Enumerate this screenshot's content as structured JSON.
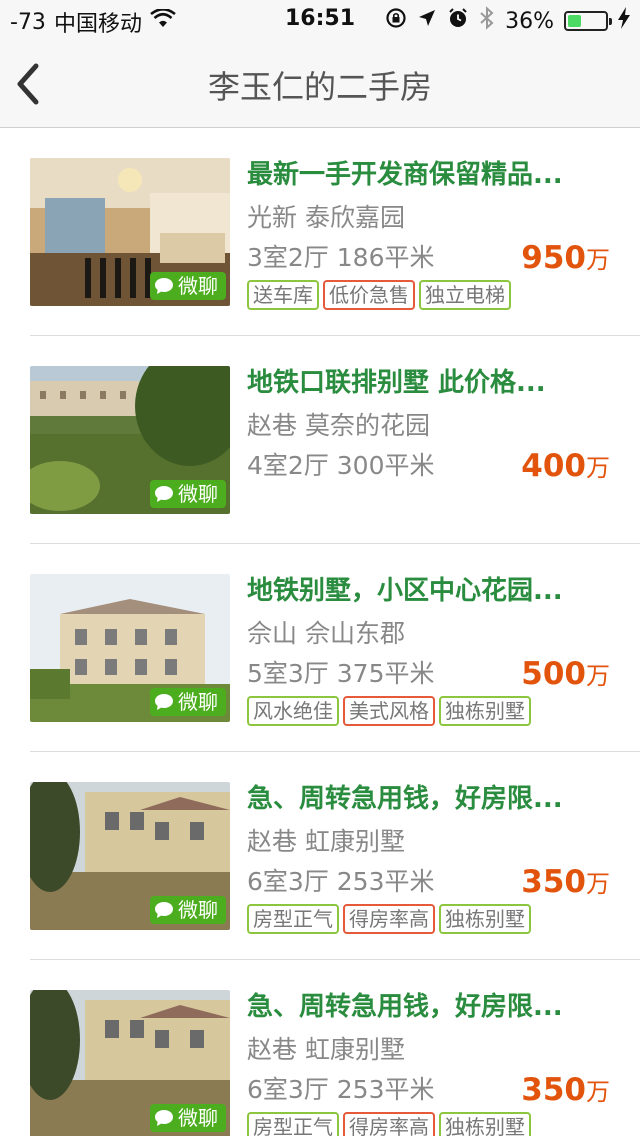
{
  "status_bar": {
    "signal": "-73",
    "carrier": "中国移动",
    "time": "16:51",
    "battery_percent": "36%",
    "battery_level": 0.36
  },
  "nav": {
    "title": "李玉仁的二手房"
  },
  "chat_label": "微聊",
  "listings": [
    {
      "title": "最新一手开发商保留精品...",
      "location": "光新  泰欣嘉园",
      "spec": "3室2厅  186平米",
      "price": "950",
      "unit": "万",
      "tags": [
        {
          "label": "送车库",
          "color": "green"
        },
        {
          "label": "低价急售",
          "color": "red"
        },
        {
          "label": "独立电梯",
          "color": "green"
        }
      ]
    },
    {
      "title": "地铁口联排别墅 此价格...",
      "location": "赵巷  莫奈的花园",
      "spec": "4室2厅  300平米",
      "price": "400",
      "unit": "万",
      "tags": []
    },
    {
      "title": "地铁别墅，小区中心花园...",
      "location": "佘山  佘山东郡",
      "spec": "5室3厅  375平米",
      "price": "500",
      "unit": "万",
      "tags": [
        {
          "label": "风水绝佳",
          "color": "green"
        },
        {
          "label": "美式风格",
          "color": "red"
        },
        {
          "label": "独栋别墅",
          "color": "green"
        }
      ]
    },
    {
      "title": "急、周转急用钱，好房限...",
      "location": "赵巷  虹康别墅",
      "spec": "6室3厅  253平米",
      "price": "350",
      "unit": "万",
      "tags": [
        {
          "label": "房型正气",
          "color": "green"
        },
        {
          "label": "得房率高",
          "color": "red"
        },
        {
          "label": "独栋别墅",
          "color": "green"
        }
      ]
    },
    {
      "title": "急、周转急用钱，好房限...",
      "location": "赵巷  虹康别墅",
      "spec": "6室3厅  253平米",
      "price": "350",
      "unit": "万",
      "tags": [
        {
          "label": "房型正气",
          "color": "green"
        },
        {
          "label": "得房率高",
          "color": "red"
        },
        {
          "label": "独栋别墅",
          "color": "green"
        }
      ]
    }
  ]
}
